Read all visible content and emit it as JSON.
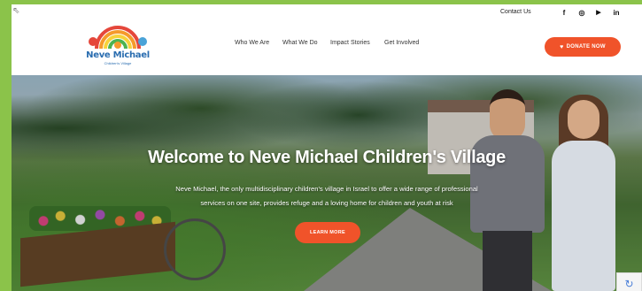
{
  "topbar": {
    "contact_label": "Contact Us",
    "social_icons": [
      {
        "name": "facebook-icon",
        "glyph": "f"
      },
      {
        "name": "instagram-icon",
        "glyph": "◎"
      },
      {
        "name": "youtube-icon",
        "glyph": "▶"
      },
      {
        "name": "linkedin-icon",
        "glyph": "in"
      }
    ]
  },
  "logo": {
    "name": "Neve Michael",
    "subtitle": "Children's Village"
  },
  "nav": {
    "items": [
      "Who We Are",
      "What We Do",
      "Impact Stories",
      "Get Involved"
    ]
  },
  "donate": {
    "label": "DONATE NOW",
    "icon": "heart-icon"
  },
  "hero": {
    "title": "Welcome to Neve Michael Children's Village",
    "description_line1": "Neve Michael, the only multidisciplinary children's village in Israel to offer a wide range of professional",
    "description_line2": "services on one site, provides refuge and a loving home for children and youth at risk",
    "cta_label": "LEARN MORE"
  },
  "colors": {
    "accent": "#f0532a",
    "page_border": "#8bc34a",
    "logo_blue": "#2a6db0"
  }
}
